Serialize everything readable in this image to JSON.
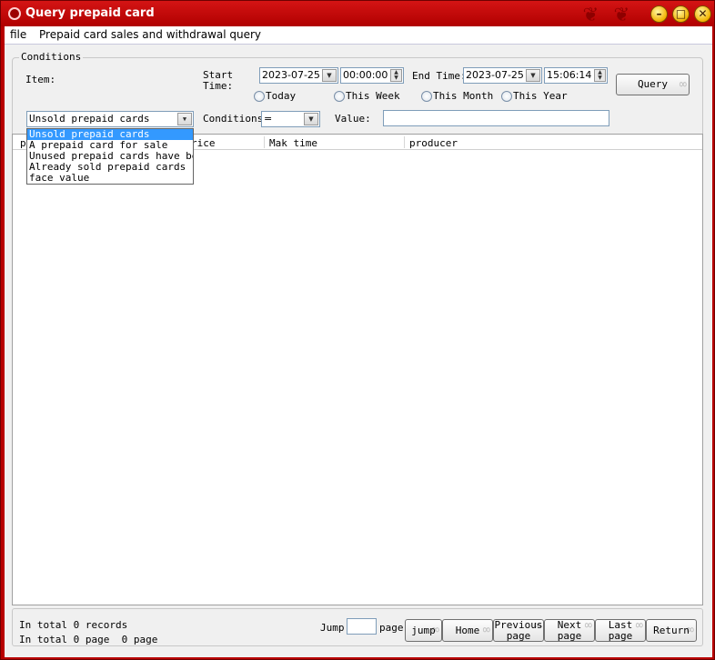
{
  "window": {
    "title": "Query prepaid card",
    "minimize": "–",
    "maximize": "□",
    "close": "✕"
  },
  "menu": {
    "file": "file",
    "query": "Prepaid card sales and withdrawal query"
  },
  "conditions": {
    "legend": "Conditions",
    "item_label": "Item:",
    "item_value": "Unsold prepaid cards",
    "start_time_label": "Start\nTime:",
    "start_date": "2023-07-25",
    "start_time": "00:00:00",
    "end_time_label": "End Time:",
    "end_date": "2023-07-25",
    "end_time": "15:06:14",
    "radios": [
      "Today",
      "This Week",
      "This Month",
      "This Year"
    ],
    "query_button": "Query",
    "conditions_label": "Conditions:",
    "conditions_value": "=",
    "value_label": "Value:",
    "value_input": ""
  },
  "item_options": [
    "Unsold prepaid cards",
    "A prepaid card for sale",
    "Unused prepaid cards have been",
    "Already sold prepaid cards",
    "face value"
  ],
  "grid": {
    "columns": [
      "p",
      "rice",
      "Mak time",
      "producer"
    ]
  },
  "footer": {
    "records": "In total 0 records",
    "pages": "In total 0 page  0 page",
    "jump_label": "Jump",
    "jump_value": "",
    "page_label": "page",
    "buttons": {
      "jump": "jump",
      "home": "Home",
      "previous": "Previous page",
      "next": "Next page",
      "last": "Last page",
      "return": "Return"
    }
  },
  "colors": {
    "titlebar": "#b80000",
    "selection": "#3399ff"
  }
}
